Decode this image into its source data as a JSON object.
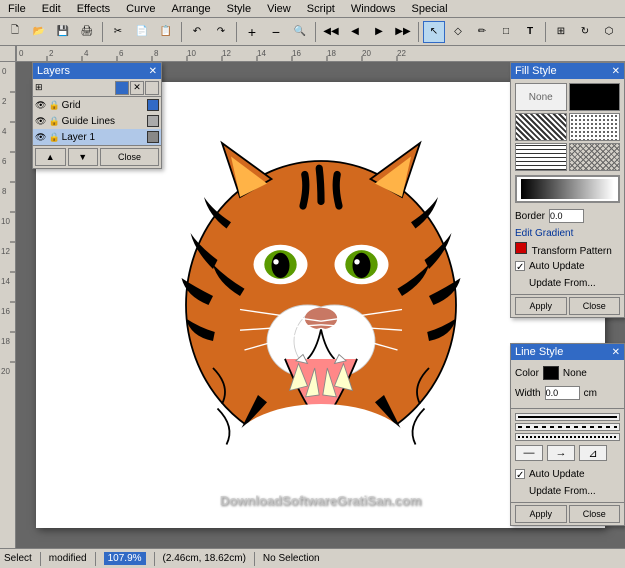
{
  "menu": {
    "items": [
      "File",
      "Edit",
      "Effects",
      "Curve",
      "Arrange",
      "Style",
      "View",
      "Script",
      "Windows",
      "Special"
    ]
  },
  "toolbar": {
    "buttons": [
      "🗋",
      "🗁",
      "💾",
      "🖨",
      "✄",
      "📋",
      "↶",
      "↷",
      "⊕",
      "⊖",
      "🔍",
      "◻",
      "⬤"
    ]
  },
  "layers_panel": {
    "title": "Layers",
    "rows": [
      {
        "name": "Grid",
        "visible": true,
        "locked": false
      },
      {
        "name": "Guide Lines",
        "visible": true,
        "locked": false
      },
      {
        "name": "Layer 1",
        "visible": true,
        "locked": false
      }
    ],
    "buttons": [
      "▲",
      "▼",
      "Close"
    ]
  },
  "fill_style": {
    "title": "Fill Style",
    "none_label": "None",
    "border_label": "Border",
    "border_value": "0.0",
    "edit_gradient_label": "Edit Gradient",
    "transform_pattern_label": "Transform Pattern",
    "auto_update_label": "Auto Update",
    "update_from_label": "Update From...",
    "apply_label": "Apply",
    "close_label": "Close"
  },
  "line_style": {
    "title": "Line Style",
    "color_label": "Color",
    "none_label": "None",
    "width_label": "Width",
    "width_value": "0.0",
    "width_unit": "cm",
    "auto_update_label": "Auto Update",
    "update_from_label": "Update From...",
    "apply_label": "Apply",
    "close_label": "Close"
  },
  "status": {
    "tool": "Select",
    "modified": "modified",
    "zoom": "107.9%",
    "coordinates": "(2.46cm, 18.62cm)",
    "selection": "No Selection"
  },
  "watermark": "DownloadSoftwareGratiSan.com"
}
